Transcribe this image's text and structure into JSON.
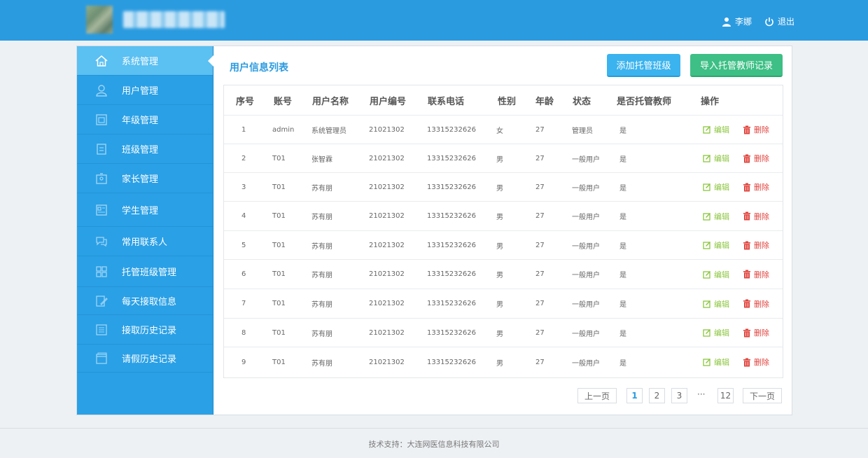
{
  "header": {
    "user_name": "李娜",
    "logout_label": "退出"
  },
  "sidebar": {
    "items": [
      {
        "label": "系统管理",
        "icon": "home-icon"
      },
      {
        "label": "用户管理",
        "icon": "user-icon"
      },
      {
        "label": "年级管理",
        "icon": "grade-icon"
      },
      {
        "label": "班级管理",
        "icon": "class-icon"
      },
      {
        "label": "家长管理",
        "icon": "parent-icon"
      },
      {
        "label": "学生管理",
        "icon": "student-icon"
      },
      {
        "label": "常用联系人",
        "icon": "contact-icon"
      },
      {
        "label": "托管班级管理",
        "icon": "grid-icon"
      },
      {
        "label": "每天接取信息",
        "icon": "edit-note-icon"
      },
      {
        "label": "接取历史记录",
        "icon": "list-icon"
      },
      {
        "label": "请假历史记录",
        "icon": "window-icon"
      }
    ]
  },
  "main": {
    "title": "用户信息列表",
    "add_button": "添加托管班级",
    "import_button": "导入托管教师记录",
    "columns": [
      "序号",
      "账号",
      "用户名称",
      "用户编号",
      "联系电话",
      "性别",
      "年龄",
      "状态",
      "是否托管教师",
      "操作"
    ],
    "rows": [
      {
        "no": "1",
        "account": "admin",
        "name": "系统管理员",
        "code": "21021302",
        "phone": "13315232626",
        "gender": "女",
        "age": "27",
        "status": "管理员",
        "teacher": "是"
      },
      {
        "no": "2",
        "account": "T01",
        "name": "张智霖",
        "code": "21021302",
        "phone": "13315232626",
        "gender": "男",
        "age": "27",
        "status": "一般用户",
        "teacher": "是"
      },
      {
        "no": "3",
        "account": "T01",
        "name": "苏有朋",
        "code": "21021302",
        "phone": "13315232626",
        "gender": "男",
        "age": "27",
        "status": "一般用户",
        "teacher": "是"
      },
      {
        "no": "4",
        "account": "T01",
        "name": "苏有朋",
        "code": "21021302",
        "phone": "13315232626",
        "gender": "男",
        "age": "27",
        "status": "一般用户",
        "teacher": "是"
      },
      {
        "no": "5",
        "account": "T01",
        "name": "苏有朋",
        "code": "21021302",
        "phone": "13315232626",
        "gender": "男",
        "age": "27",
        "status": "一般用户",
        "teacher": "是"
      },
      {
        "no": "6",
        "account": "T01",
        "name": "苏有朋",
        "code": "21021302",
        "phone": "13315232626",
        "gender": "男",
        "age": "27",
        "status": "一般用户",
        "teacher": "是"
      },
      {
        "no": "7",
        "account": "T01",
        "name": "苏有朋",
        "code": "21021302",
        "phone": "13315232626",
        "gender": "男",
        "age": "27",
        "status": "一般用户",
        "teacher": "是"
      },
      {
        "no": "8",
        "account": "T01",
        "name": "苏有朋",
        "code": "21021302",
        "phone": "13315232626",
        "gender": "男",
        "age": "27",
        "status": "一般用户",
        "teacher": "是"
      },
      {
        "no": "9",
        "account": "T01",
        "name": "苏有朋",
        "code": "21021302",
        "phone": "13315232626",
        "gender": "男",
        "age": "27",
        "status": "一般用户",
        "teacher": "是"
      }
    ],
    "edit_label": "编辑",
    "delete_label": "删除"
  },
  "pagination": {
    "prev": "上一页",
    "pages": [
      "1",
      "2",
      "3"
    ],
    "ellipsis": "···",
    "last": "12",
    "next": "下一页",
    "current": "1"
  },
  "footer": {
    "text": "技术支持：大连网医信息科技有限公司"
  },
  "colors": {
    "header": "#2b9be0",
    "sidebar": "#2aa0e6",
    "active_item": "#5bc0f2",
    "edit": "#8cc63f",
    "delete": "#e0433d",
    "import_button": "#3dbf85",
    "add_button": "#3bb3ee"
  }
}
